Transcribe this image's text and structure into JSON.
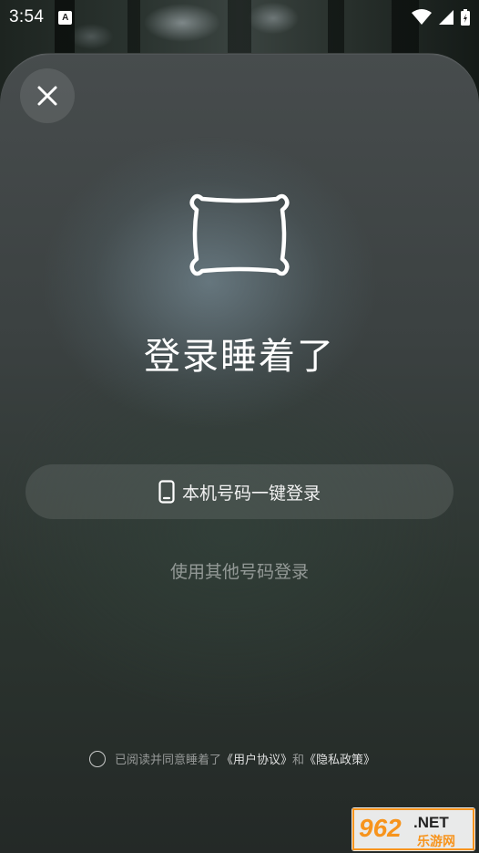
{
  "status_bar": {
    "time": "3:54",
    "notification_icon": "a-box-icon",
    "icons": [
      "wifi-icon",
      "signal-icon",
      "battery-charging-icon"
    ]
  },
  "sheet": {
    "close_icon": "close-icon",
    "logo_icon": "pillow-icon",
    "title": "登录睡着了",
    "one_click_login_label": "本机号码一键登录",
    "one_click_login_icon": "phone-icon",
    "other_number_login_label": "使用其他号码登录",
    "agreement": {
      "checked": false,
      "prefix": "已阅读并同意睡着了",
      "user_agreement": "《用户协议》",
      "conjunction": "和",
      "privacy_policy": "《隐私政策》"
    }
  },
  "watermark": {
    "number": "962",
    "suffix": ".NET",
    "subtitle": "乐游网"
  },
  "colors": {
    "sheet_top": "#474c4d",
    "sheet_bottom": "#232826",
    "text_primary": "#ffffff",
    "text_muted": "rgba(255,255,255,0.48)",
    "watermark_orange": "#f7941d"
  }
}
